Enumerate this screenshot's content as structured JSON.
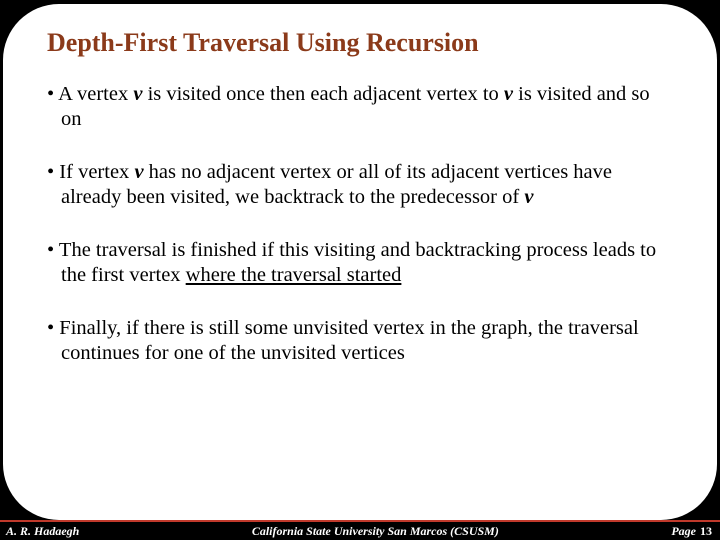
{
  "title": "Depth-First Traversal Using Recursion",
  "bullets": [
    {
      "prefix": "• A vertex ",
      "v1": "v",
      "mid1": " is visited once then each adjacent vertex to ",
      "v2": "v",
      "suffix": " is visited and so on"
    },
    {
      "prefix": "• If vertex ",
      "v1": "v",
      "mid1": " has no adjacent vertex or all of its adjacent vertices have already been visited, we backtrack to the predecessor of ",
      "v2": "v",
      "suffix": ""
    },
    {
      "prefix": "• The traversal is finished if this visiting and backtracking process leads to the first vertex ",
      "ul": "where the traversal started",
      "suffix": ""
    },
    {
      "prefix": "• Finally, if there is still some unvisited vertex in the graph, the traversal continues for one of the unvisited vertices",
      "suffix": ""
    }
  ],
  "footer": {
    "author": "A. R. Hadaegh",
    "institution": "California State University San Marcos (CSUSM)",
    "page_label": "Page",
    "page_num": "13"
  }
}
